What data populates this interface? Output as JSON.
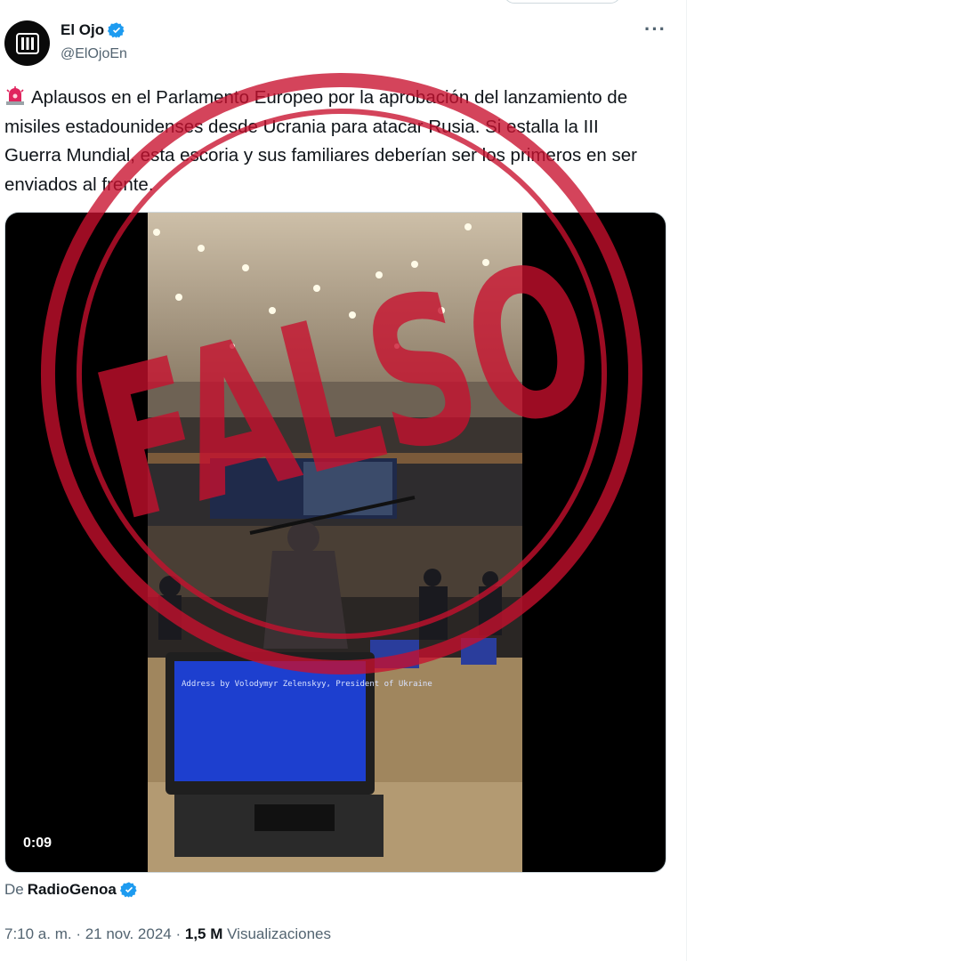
{
  "tweet": {
    "display_name": "El Ojo",
    "handle": "@ElOjoEn",
    "more_label": "···",
    "text": "Aplausos en el Parlamento Europeo por la aprobación del lanzamiento de misiles estadounidenses desde Ucrania para atacar Rusia. Si estalla la III Guerra Mundial, esta escoria y sus familiares deberían ser los primeros en ser enviados al frente.",
    "video_duration": "0:09",
    "video_screen_text": "Address by Volodymyr Zelenskyy, President of Ukraine",
    "via_prefix": "De",
    "via_name": "RadioGenoa",
    "timestamp": "7:10 a. m. · 21 nov. 2024 ·",
    "views_count": "1,5 M",
    "views_label": "Visualizaciones"
  },
  "overlay": {
    "stamp_text": "FALSO",
    "stamp_color": "#c8102e"
  },
  "icons": {
    "avatar": "eye-logo-icon",
    "verified": "verified-badge-icon",
    "siren": "siren-emoji-icon",
    "more": "more-icon"
  },
  "colors": {
    "verified_blue": "#1d9bf0",
    "secondary_text": "#536471"
  }
}
